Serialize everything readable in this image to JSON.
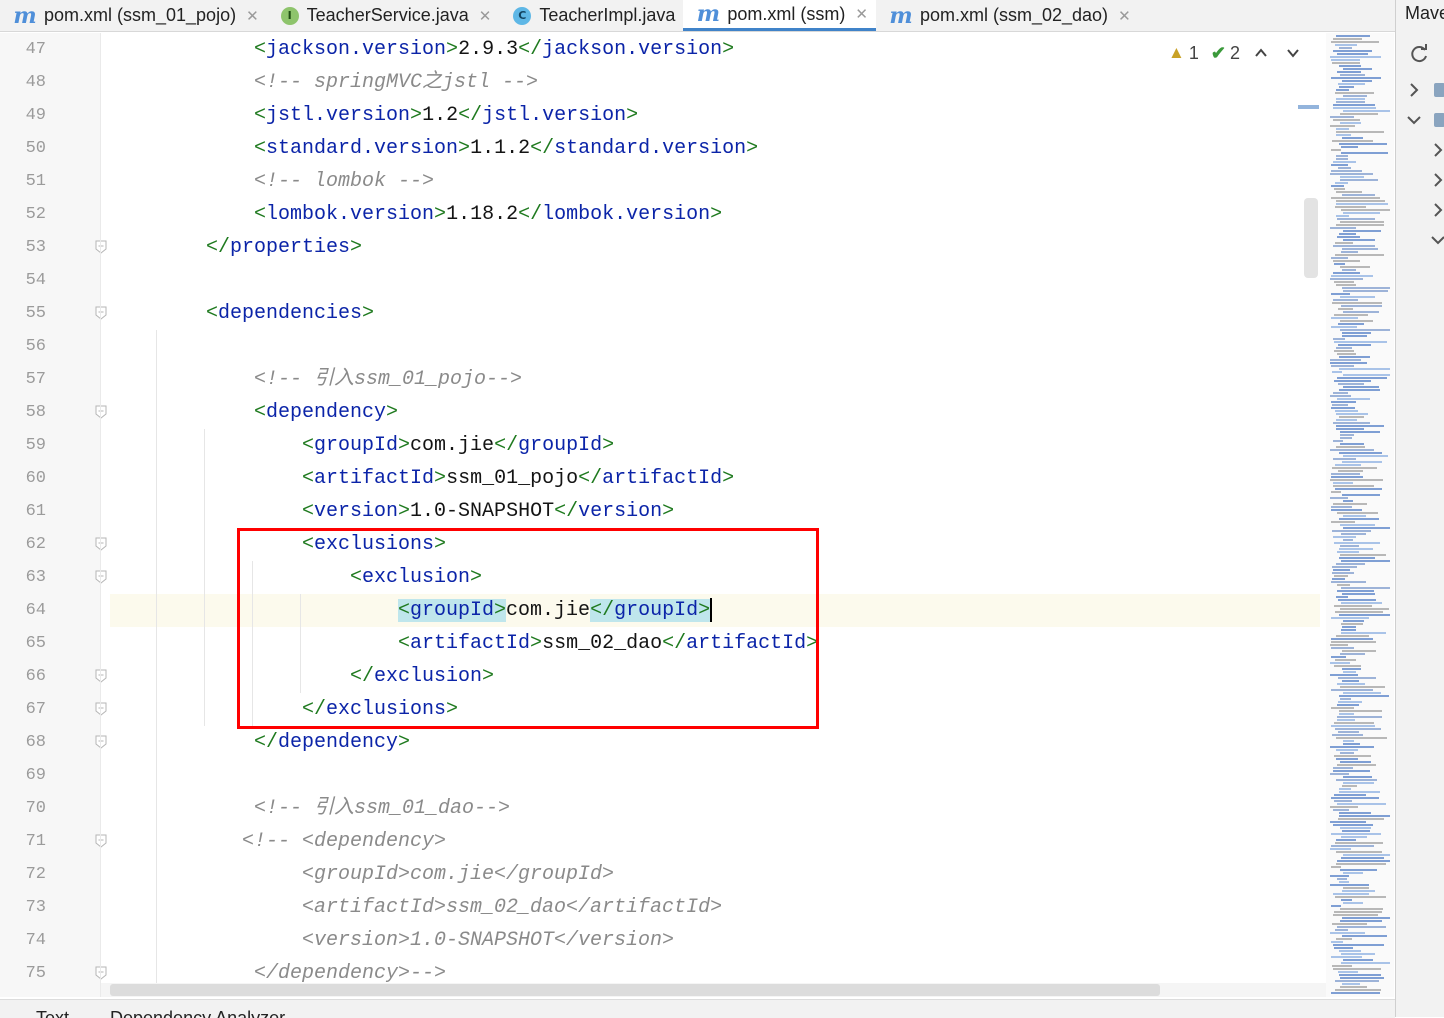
{
  "tabs": [
    {
      "label": "pom.xml (ssm_01_pojo)",
      "icon": "maven-icon",
      "glyph": "m",
      "active": false,
      "closable": true
    },
    {
      "label": "TeacherService.java",
      "icon": "interface-icon",
      "glyph": "I",
      "active": false,
      "closable": true
    },
    {
      "label": "TeacherImpl.java",
      "icon": "class-icon",
      "glyph": "C",
      "active": false,
      "closable": false
    },
    {
      "label": "pom.xml (ssm)",
      "icon": "maven-icon",
      "glyph": "m",
      "active": true,
      "closable": true
    },
    {
      "label": "pom.xml (ssm_02_dao)",
      "icon": "maven-icon",
      "glyph": "m",
      "active": false,
      "closable": true
    }
  ],
  "right_panel": {
    "title": "Mave"
  },
  "inspections": {
    "warnings": "1",
    "weak_warnings": "2"
  },
  "status_bar": {
    "tabs": [
      "Text",
      "Dependency Analyzer"
    ]
  },
  "editor": {
    "current_line": 64,
    "lines": [
      {
        "n": "47",
        "fold": false,
        "tokens": [
          [
            "b",
            "<"
          ],
          [
            "t",
            "jackson.version"
          ],
          [
            "b",
            ">"
          ],
          [
            "tx",
            "2.9.3"
          ],
          [
            "b",
            "</"
          ],
          [
            "t",
            "jackson.version"
          ],
          [
            "b",
            ">"
          ]
        ]
      },
      {
        "n": "48",
        "fold": false,
        "tokens": [
          [
            "cm",
            "<!-- springMVC之jstl -->"
          ]
        ]
      },
      {
        "n": "49",
        "fold": false,
        "tokens": [
          [
            "b",
            "<"
          ],
          [
            "t",
            "jstl.version"
          ],
          [
            "b",
            ">"
          ],
          [
            "tx",
            "1.2"
          ],
          [
            "b",
            "</"
          ],
          [
            "t",
            "jstl.version"
          ],
          [
            "b",
            ">"
          ]
        ]
      },
      {
        "n": "50",
        "fold": false,
        "tokens": [
          [
            "b",
            "<"
          ],
          [
            "t",
            "standard.version"
          ],
          [
            "b",
            ">"
          ],
          [
            "tx",
            "1.1.2"
          ],
          [
            "b",
            "</"
          ],
          [
            "t",
            "standard.version"
          ],
          [
            "b",
            ">"
          ]
        ]
      },
      {
        "n": "51",
        "fold": false,
        "tokens": [
          [
            "cm",
            "<!-- lombok -->"
          ]
        ]
      },
      {
        "n": "52",
        "fold": false,
        "tokens": [
          [
            "b",
            "<"
          ],
          [
            "t",
            "lombok.version"
          ],
          [
            "b",
            ">"
          ],
          [
            "tx",
            "1.18.2"
          ],
          [
            "b",
            "</"
          ],
          [
            "t",
            "lombok.version"
          ],
          [
            "b",
            ">"
          ]
        ]
      },
      {
        "n": "53",
        "fold": true,
        "tokens": [
          [
            "b",
            "</"
          ],
          [
            "t",
            "properties"
          ],
          [
            "b",
            ">"
          ]
        ]
      },
      {
        "n": "54",
        "fold": false,
        "tokens": []
      },
      {
        "n": "55",
        "fold": true,
        "tokens": [
          [
            "b",
            "<"
          ],
          [
            "t",
            "dependencies"
          ],
          [
            "b",
            ">"
          ]
        ]
      },
      {
        "n": "56",
        "fold": false,
        "tokens": []
      },
      {
        "n": "57",
        "fold": false,
        "tokens": [
          [
            "cm",
            "<!-- 引入ssm_01_pojo-->"
          ]
        ]
      },
      {
        "n": "58",
        "fold": true,
        "tokens": [
          [
            "b",
            "<"
          ],
          [
            "t",
            "dependency"
          ],
          [
            "b",
            ">"
          ]
        ]
      },
      {
        "n": "59",
        "fold": false,
        "tokens": [
          [
            "b",
            "<"
          ],
          [
            "t",
            "groupId"
          ],
          [
            "b",
            ">"
          ],
          [
            "tx",
            "com.jie"
          ],
          [
            "b",
            "</"
          ],
          [
            "t",
            "groupId"
          ],
          [
            "b",
            ">"
          ]
        ]
      },
      {
        "n": "60",
        "fold": false,
        "tokens": [
          [
            "b",
            "<"
          ],
          [
            "t",
            "artifactId"
          ],
          [
            "b",
            ">"
          ],
          [
            "tx",
            "ssm_01_pojo"
          ],
          [
            "b",
            "</"
          ],
          [
            "t",
            "artifactId"
          ],
          [
            "b",
            ">"
          ]
        ]
      },
      {
        "n": "61",
        "fold": false,
        "tokens": [
          [
            "b",
            "<"
          ],
          [
            "t",
            "version"
          ],
          [
            "b",
            ">"
          ],
          [
            "tx",
            "1.0-SNAPSHOT"
          ],
          [
            "b",
            "</"
          ],
          [
            "t",
            "version"
          ],
          [
            "b",
            ">"
          ]
        ]
      },
      {
        "n": "62",
        "fold": true,
        "tokens": [
          [
            "b",
            "<"
          ],
          [
            "t",
            "exclusions"
          ],
          [
            "b",
            ">"
          ]
        ]
      },
      {
        "n": "63",
        "fold": true,
        "tokens": [
          [
            "b",
            "<"
          ],
          [
            "t",
            "exclusion"
          ],
          [
            "b",
            ">"
          ]
        ]
      },
      {
        "n": "64",
        "fold": false,
        "tokens": [
          [
            "b hl",
            "<"
          ],
          [
            "t hl",
            "groupId"
          ],
          [
            "b hl",
            ">"
          ],
          [
            "tx",
            "com.jie"
          ],
          [
            "b hl",
            "</"
          ],
          [
            "t hl",
            "groupId"
          ],
          [
            "b hl",
            ">"
          ]
        ]
      },
      {
        "n": "65",
        "fold": false,
        "tokens": [
          [
            "b",
            "<"
          ],
          [
            "t",
            "artifactId"
          ],
          [
            "b",
            ">"
          ],
          [
            "tx",
            "ssm_02_dao"
          ],
          [
            "b",
            "</"
          ],
          [
            "t",
            "artifactId"
          ],
          [
            "b",
            ">"
          ]
        ]
      },
      {
        "n": "66",
        "fold": true,
        "tokens": [
          [
            "b",
            "</"
          ],
          [
            "t",
            "exclusion"
          ],
          [
            "b",
            ">"
          ]
        ]
      },
      {
        "n": "67",
        "fold": true,
        "tokens": [
          [
            "b",
            "</"
          ],
          [
            "t",
            "exclusions"
          ],
          [
            "b",
            ">"
          ]
        ]
      },
      {
        "n": "68",
        "fold": true,
        "tokens": [
          [
            "b",
            "</"
          ],
          [
            "t",
            "dependency"
          ],
          [
            "b",
            ">"
          ]
        ]
      },
      {
        "n": "69",
        "fold": false,
        "tokens": []
      },
      {
        "n": "70",
        "fold": false,
        "tokens": [
          [
            "cm",
            "<!-- 引入ssm_01_dao-->"
          ]
        ]
      },
      {
        "n": "71",
        "fold": true,
        "tokens": [
          [
            "cm",
            "<!-- <dependency>"
          ]
        ]
      },
      {
        "n": "72",
        "fold": false,
        "tokens": [
          [
            "cm",
            "<groupId>com.jie</groupId>"
          ]
        ]
      },
      {
        "n": "73",
        "fold": false,
        "tokens": [
          [
            "cm",
            "<artifactId>ssm_02_dao</artifactId>"
          ]
        ]
      },
      {
        "n": "74",
        "fold": false,
        "tokens": [
          [
            "cm",
            "<version>1.0-SNAPSHOT</version>"
          ]
        ]
      },
      {
        "n": "75",
        "fold": true,
        "tokens": [
          [
            "cm",
            "</dependency>-->"
          ]
        ]
      }
    ]
  }
}
